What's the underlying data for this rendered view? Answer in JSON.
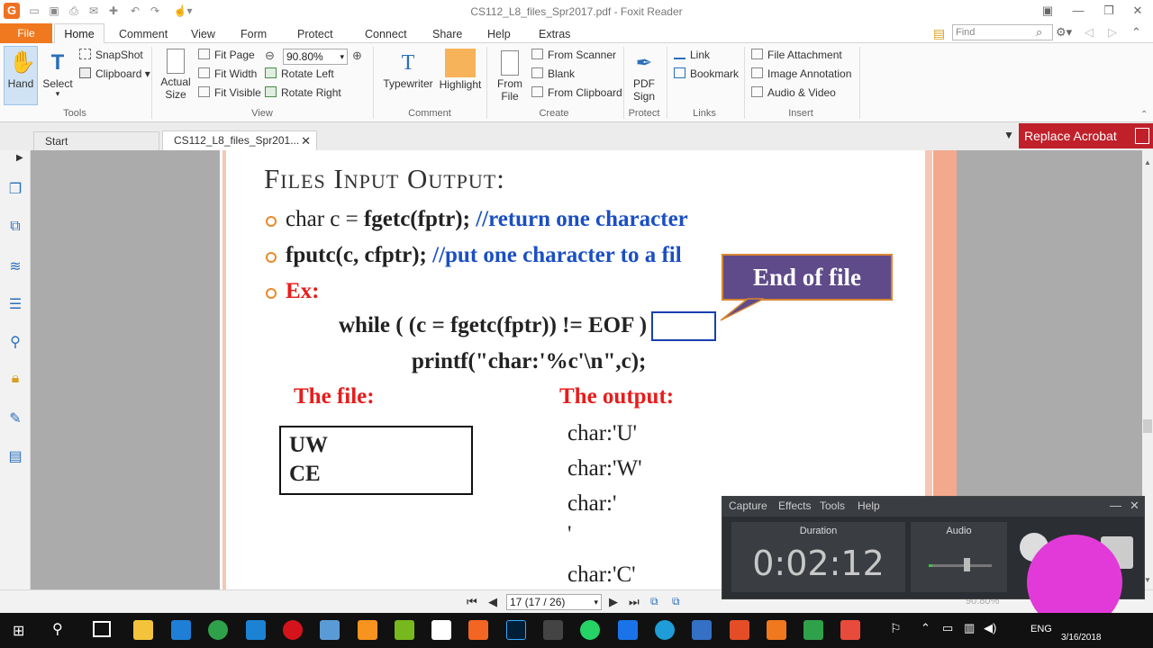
{
  "titlebar": {
    "title": "CS112_L8_files_Spr2017.pdf - Foxit Reader"
  },
  "menubar": {
    "file": "File",
    "tabs": [
      "Home",
      "Comment",
      "View",
      "Form",
      "Protect",
      "Connect",
      "Share",
      "Help",
      "Extras"
    ],
    "find_placeholder": "Find"
  },
  "ribbon": {
    "tools": {
      "hand": "Hand",
      "select": "Select",
      "snapshot": "SnapShot",
      "clipboard": "Clipboard",
      "label": "Tools"
    },
    "view": {
      "actual_size": "Actual Size",
      "fit_page": "Fit Page",
      "fit_width": "Fit Width",
      "fit_visible": "Fit Visible",
      "zoom": "90.80%",
      "rotate_left": "Rotate Left",
      "rotate_right": "Rotate Right",
      "label": "View"
    },
    "comment": {
      "typewriter": "Typewriter",
      "highlight": "Highlight",
      "label": "Comment"
    },
    "create": {
      "from_file": "From File",
      "from_scanner": "From Scanner",
      "blank": "Blank",
      "from_clipboard": "From Clipboard",
      "label": "Create"
    },
    "protect": {
      "pdf_sign": "PDF Sign",
      "label": "Protect"
    },
    "links": {
      "link": "Link",
      "bookmark": "Bookmark",
      "label": "Links"
    },
    "insert": {
      "file_attachment": "File Attachment",
      "image_annotation": "Image Annotation",
      "audio_video": "Audio & Video",
      "label": "Insert"
    }
  },
  "tabs": {
    "start": "Start",
    "doc": "CS112_L8_files_Spr201..."
  },
  "ad": {
    "replace_acrobat": "Replace Acrobat"
  },
  "slide": {
    "title": "Files Input Output:",
    "bullet1_code": "char c = ",
    "bullet1_bold": "fgetc(fptr);",
    "bullet1_comment": " //return one character",
    "bullet2_code": "fputc(c, cfptr);",
    "bullet2_comment": " //put one character to a fil",
    "ex": "Ex:",
    "while_a": "while ( (c = fgetc(fptr)) != ",
    "while_eof": "EOF",
    "while_b": " )",
    "printf": "printf(\"char:'%c'\\n\",c);",
    "file_heading": "The file:",
    "output_heading": "The output:",
    "file_lines": [
      "UW",
      "CE"
    ],
    "output_lines": [
      "char:'U'",
      "char:'W'",
      "char:'",
      "'",
      "char:'C'"
    ],
    "callout": "End of file"
  },
  "nav": {
    "page": "17 (17 / 26)",
    "zoom": "90.80%"
  },
  "recorder": {
    "menu": [
      "Capture",
      "Effects",
      "Tools",
      "Help"
    ],
    "duration_label": "Duration",
    "time": "0:02:12",
    "audio_label": "Audio"
  },
  "taskbar": {
    "lang": "ENG",
    "date": "3/16/2018"
  }
}
